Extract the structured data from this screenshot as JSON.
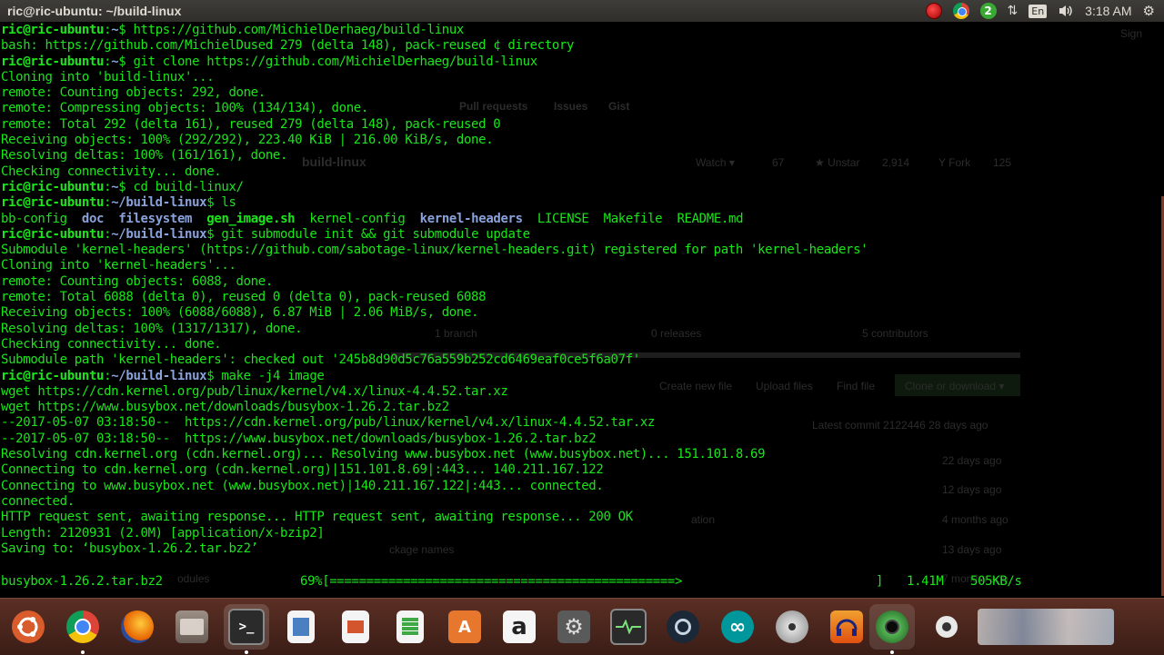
{
  "window": {
    "title": "ric@ric-ubuntu: ~/build-linux"
  },
  "panel": {
    "indicators": [
      {
        "icon": "record-icon",
        "text": ""
      },
      {
        "icon": "chrome-icon",
        "text": ""
      },
      {
        "icon": "update-badge-icon",
        "text": "2"
      },
      {
        "icon": "network-arrows-icon",
        "text": "⇅"
      },
      {
        "icon": "keyboard-layout-icon",
        "text": "En"
      },
      {
        "icon": "volume-icon",
        "text": "🕪"
      }
    ],
    "clock": "3:18 AM",
    "settings_icon": "⚙"
  },
  "terminal": {
    "prompt_user": "ric@ric-ubuntu",
    "lines": [
      {
        "type": "prompt",
        "path": "~",
        "cmd": " https://github.com/MichielDerhaeg/build-linux"
      },
      {
        "type": "out",
        "text": "bash: https://github.com/MichielDused 279 (delta 148), pack-reused ¢ directory"
      },
      {
        "type": "prompt",
        "path": "~",
        "cmd": " git clone https://github.com/MichielDerhaeg/build-linux"
      },
      {
        "type": "out",
        "text": "Cloning into 'build-linux'..."
      },
      {
        "type": "out",
        "text": "remote: Counting objects: 292, done."
      },
      {
        "type": "out",
        "text": "remote: Compressing objects: 100% (134/134), done."
      },
      {
        "type": "out",
        "text": "remote: Total 292 (delta 161), reused 279 (delta 148), pack-reused 0"
      },
      {
        "type": "out",
        "text": "Receiving objects: 100% (292/292), 223.40 KiB | 216.00 KiB/s, done."
      },
      {
        "type": "out",
        "text": "Resolving deltas: 100% (161/161), done."
      },
      {
        "type": "out",
        "text": "Checking connectivity... done."
      },
      {
        "type": "prompt",
        "path": "~",
        "cmd": " cd build-linux/"
      },
      {
        "type": "prompt",
        "path": "~/build-linux",
        "cmd": " ls"
      },
      {
        "type": "ls",
        "items": [
          {
            "text": "bb-config",
            "kind": "file"
          },
          {
            "text": "doc",
            "kind": "dir"
          },
          {
            "text": "filesystem",
            "kind": "dir"
          },
          {
            "text": "gen_image.sh",
            "kind": "exe"
          },
          {
            "text": "kernel-config",
            "kind": "file"
          },
          {
            "text": "kernel-headers",
            "kind": "dir"
          },
          {
            "text": "LICENSE",
            "kind": "file"
          },
          {
            "text": "Makefile",
            "kind": "file"
          },
          {
            "text": "README.md",
            "kind": "file"
          }
        ]
      },
      {
        "type": "prompt",
        "path": "~/build-linux",
        "cmd": " git submodule init && git submodule update"
      },
      {
        "type": "out",
        "text": "Submodule 'kernel-headers' (https://github.com/sabotage-linux/kernel-headers.git) registered for path 'kernel-headers'"
      },
      {
        "type": "out",
        "text": "Cloning into 'kernel-headers'..."
      },
      {
        "type": "out",
        "text": "remote: Counting objects: 6088, done."
      },
      {
        "type": "out",
        "text": "remote: Total 6088 (delta 0), reused 0 (delta 0), pack-reused 6088"
      },
      {
        "type": "out",
        "text": "Receiving objects: 100% (6088/6088), 6.87 MiB | 2.06 MiB/s, done."
      },
      {
        "type": "out",
        "text": "Resolving deltas: 100% (1317/1317), done."
      },
      {
        "type": "out",
        "text": "Checking connectivity... done."
      },
      {
        "type": "out",
        "text": "Submodule path 'kernel-headers': checked out '245b8d90d5c76a559b252cd6469eaf0ce5f6a07f'"
      },
      {
        "type": "prompt",
        "path": "~/build-linux",
        "cmd": " make -j4 image"
      },
      {
        "type": "out",
        "text": "wget https://cdn.kernel.org/pub/linux/kernel/v4.x/linux-4.4.52.tar.xz"
      },
      {
        "type": "out",
        "text": "wget https://www.busybox.net/downloads/busybox-1.26.2.tar.bz2"
      },
      {
        "type": "out",
        "text": "--2017-05-07 03:18:50--  https://cdn.kernel.org/pub/linux/kernel/v4.x/linux-4.4.52.tar.xz"
      },
      {
        "type": "out",
        "text": "--2017-05-07 03:18:50--  https://www.busybox.net/downloads/busybox-1.26.2.tar.bz2"
      },
      {
        "type": "out",
        "text": "Resolving cdn.kernel.org (cdn.kernel.org)... Resolving www.busybox.net (www.busybox.net)... 151.101.8.69"
      },
      {
        "type": "out",
        "text": "Connecting to cdn.kernel.org (cdn.kernel.org)|151.101.8.69|:443... 140.211.167.122"
      },
      {
        "type": "out",
        "text": "Connecting to www.busybox.net (www.busybox.net)|140.211.167.122|:443... connected."
      },
      {
        "type": "out",
        "text": "connected."
      },
      {
        "type": "out",
        "text": "HTTP request sent, awaiting response... HTTP request sent, awaiting response... 200 OK"
      },
      {
        "type": "out",
        "text": "Length: 2120931 (2.0M) [application/x-bzip2]"
      },
      {
        "type": "out",
        "text": "Saving to: ‘busybox-1.26.2.tar.bz2’"
      },
      {
        "type": "out",
        "text": ""
      }
    ],
    "progress": {
      "filename": "busybox-1.26.2.tar.bz2",
      "percent_text": "69%[===============================================>",
      "bar_end": "]",
      "size": "1.41M",
      "speed": "505KB/s",
      "fraction": 0.69
    }
  },
  "background_browser": {
    "labels": [
      "Sign",
      "Pull requests",
      "Issues",
      "Gist",
      "build-linux",
      "Watch ▾",
      "67",
      "★ Unstar",
      "2,914",
      "Y Fork",
      "125",
      "1 branch",
      "0 releases",
      "5 contributors",
      "Create new file",
      "Upload files",
      "Find file",
      "Clone or download ▾",
      "Latest commit 2122446 28 days ago",
      "22 days ago",
      "12 days ago",
      "4 months ago",
      "13 days ago",
      "7 months ago",
      "Nathan",
      "Nat Beam",
      "ation",
      "ckage names",
      "odules"
    ]
  },
  "dock": {
    "items": [
      {
        "name": "ubuntu-dash-icon",
        "label": "",
        "running": false
      },
      {
        "name": "chrome-icon",
        "label": "",
        "running": true
      },
      {
        "name": "firefox-icon",
        "label": "",
        "running": false
      },
      {
        "name": "files-icon",
        "label": "",
        "running": false
      },
      {
        "name": "terminal-icon",
        "label": ">_",
        "running": true
      },
      {
        "name": "libreoffice-writer-icon",
        "label": "",
        "running": false
      },
      {
        "name": "libreoffice-impress-icon",
        "label": "",
        "running": false
      },
      {
        "name": "libreoffice-calc-icon",
        "label": "",
        "running": false
      },
      {
        "name": "software-center-icon",
        "label": "A",
        "running": false
      },
      {
        "name": "amazon-icon",
        "label": "a",
        "running": false
      },
      {
        "name": "system-settings-icon",
        "label": "",
        "running": false
      },
      {
        "name": "system-monitor-icon",
        "label": "",
        "running": false
      },
      {
        "name": "steam-icon",
        "label": "",
        "running": false
      },
      {
        "name": "arduino-icon",
        "label": "∞",
        "running": false
      },
      {
        "name": "disk-utility-icon",
        "label": "",
        "running": false
      },
      {
        "name": "audacity-icon",
        "label": "",
        "running": false
      },
      {
        "name": "camera-icon",
        "label": "",
        "running": true
      },
      {
        "name": "webcam-icon",
        "label": "",
        "running": false
      },
      {
        "name": "trash-icon",
        "label": "",
        "running": false
      }
    ]
  },
  "colors": {
    "terminal_fg": "#19e619",
    "directory": "#8aa2dc",
    "panel_bg": "#3e3d39",
    "dock_bg": "#5b2f24"
  }
}
